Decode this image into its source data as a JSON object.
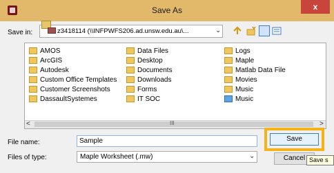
{
  "window": {
    "title": "Save As",
    "close_label": "x"
  },
  "save_in": {
    "label": "Save in:",
    "value": "z3418114 (\\\\INFPWFS206.ad.unsw.edu.au\\..."
  },
  "files": [
    {
      "label": "AMOS",
      "kind": "folder"
    },
    {
      "label": "ArcGIS",
      "kind": "folder"
    },
    {
      "label": "Autodesk",
      "kind": "folder"
    },
    {
      "label": "Custom Office Templates",
      "kind": "folder"
    },
    {
      "label": "Customer Screenshots",
      "kind": "folder"
    },
    {
      "label": "DassaultSystemes",
      "kind": "folder"
    },
    {
      "label": "Data Files",
      "kind": "folder"
    },
    {
      "label": "Desktop",
      "kind": "folder"
    },
    {
      "label": "Documents",
      "kind": "folder"
    },
    {
      "label": "Downloads",
      "kind": "folder"
    },
    {
      "label": "Forms",
      "kind": "folder"
    },
    {
      "label": "IT SOC",
      "kind": "folder"
    },
    {
      "label": "Logs",
      "kind": "folder"
    },
    {
      "label": "Maple",
      "kind": "folder"
    },
    {
      "label": "Matlab Data File",
      "kind": "folder"
    },
    {
      "label": "Movies",
      "kind": "folder"
    },
    {
      "label": "Music",
      "kind": "folder"
    },
    {
      "label": "Music",
      "kind": "special-folder"
    }
  ],
  "scrollbar": {
    "left_arrow": "<",
    "right_arrow": ">",
    "grip": "III"
  },
  "file_name": {
    "label": "File name:",
    "value": "Sample"
  },
  "file_type": {
    "label": "Files of type:",
    "value": "Maple Worksheet (.mw)"
  },
  "buttons": {
    "save_label": "Save",
    "cancel_label": "Cancel"
  },
  "tooltip": "Save s",
  "colors": {
    "titlebar": "#e2b86a",
    "highlight": "#f5b21a",
    "close": "#c7453a"
  }
}
